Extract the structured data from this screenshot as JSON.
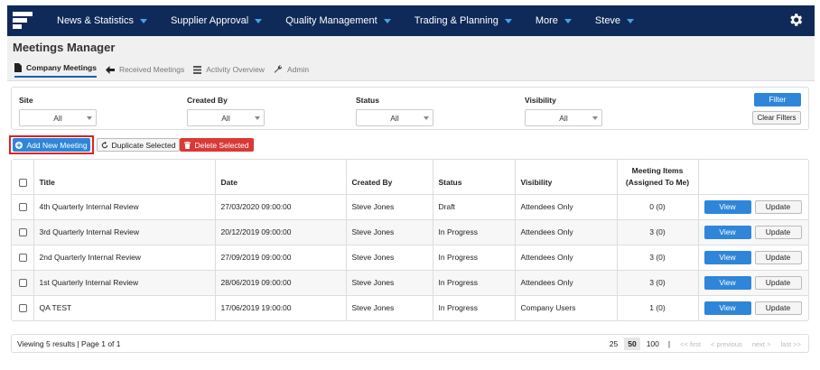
{
  "nav": {
    "items": [
      {
        "label": "News & Statistics"
      },
      {
        "label": "Supplier Approval"
      },
      {
        "label": "Quality Management"
      },
      {
        "label": "Trading & Planning"
      },
      {
        "label": "More"
      },
      {
        "label": "Steve"
      }
    ],
    "icons": {
      "logo": "logo-icon",
      "settings": "gear-icon"
    }
  },
  "page": {
    "title": "Meetings Manager",
    "tabs": [
      {
        "label": "Company Meetings",
        "icon": "document-icon",
        "active": true
      },
      {
        "label": "Received Meetings",
        "icon": "arrow-left-icon"
      },
      {
        "label": "Activity Overview",
        "icon": "list-icon"
      },
      {
        "label": "Admin",
        "icon": "wrench-icon"
      }
    ]
  },
  "filters": {
    "site": {
      "label": "Site",
      "value": "All"
    },
    "created_by": {
      "label": "Created By",
      "value": "All"
    },
    "status": {
      "label": "Status",
      "value": "All"
    },
    "visibility": {
      "label": "Visibility",
      "value": "All"
    },
    "filter_button": "Filter",
    "clear_button": "Clear Filters"
  },
  "actions": {
    "add": "Add New Meeting",
    "duplicate": "Duplicate Selected",
    "delete": "Delete Selected"
  },
  "table": {
    "columns": [
      "Title",
      "Date",
      "Created By",
      "Status",
      "Visibility",
      "Meeting Items",
      "(Assigned To Me)"
    ],
    "view_label": "View",
    "update_label": "Update",
    "rows": [
      {
        "title": "4th Quarterly Internal Review",
        "date": "27/03/2020 09:00:00",
        "created_by": "Steve Jones",
        "status": "Draft",
        "visibility": "Attendees Only",
        "items": "0 (0)"
      },
      {
        "title": "3rd Quarterly Internal Review",
        "date": "20/12/2019 09:00:00",
        "created_by": "Steve Jones",
        "status": "In Progress",
        "visibility": "Attendees Only",
        "items": "3 (0)"
      },
      {
        "title": "2nd Quarterly Internal Review",
        "date": "27/09/2019 09:00:00",
        "created_by": "Steve Jones",
        "status": "In Progress",
        "visibility": "Attendees Only",
        "items": "3 (0)"
      },
      {
        "title": "1st Quarterly Internal Review",
        "date": "28/06/2019 09:00:00",
        "created_by": "Steve Jones",
        "status": "In Progress",
        "visibility": "Attendees Only",
        "items": "3 (0)"
      },
      {
        "title": "QA TEST",
        "date": "17/06/2019 19:00:00",
        "created_by": "Steve Jones",
        "status": "In Progress",
        "visibility": "Company Users",
        "items": "1 (0)"
      }
    ]
  },
  "footer": {
    "viewing": "Viewing 5 results | Page 1 of 1",
    "page_sizes": [
      "25",
      "50",
      "100"
    ],
    "active_page_size": "50",
    "separator": "|",
    "first": "<< first",
    "previous": "< previous",
    "next": "next >",
    "last": "last >>"
  },
  "colors": {
    "nav_bg": "#0f2a59",
    "primary": "#2f86d9",
    "danger": "#d93a36",
    "highlight": "#e02020"
  }
}
